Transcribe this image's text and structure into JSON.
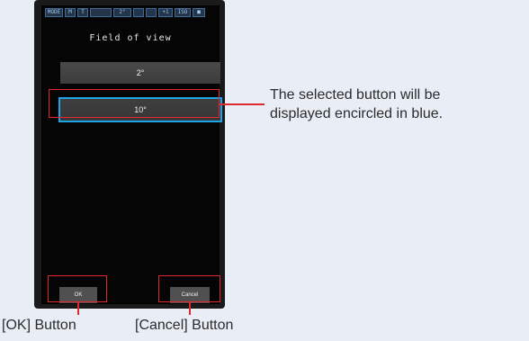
{
  "device": {
    "status_bar": [
      "MODE",
      "M",
      "T",
      "",
      "2°",
      "",
      "",
      "+1",
      "ISO",
      "■"
    ],
    "title": "Field of view",
    "options": [
      "2°",
      "10°"
    ],
    "selected_option": "10°",
    "softkeys": {
      "ok": "OK",
      "cancel": "Cancel"
    }
  },
  "annotations": {
    "selected_note_line1": "The selected button will be",
    "selected_note_line2": "displayed encircled in blue.",
    "ok_label": "[OK] Button",
    "cancel_label": "[Cancel] Button"
  },
  "colors": {
    "highlight_blue": "#1fa4e6",
    "callout_red": "#e0282f"
  }
}
